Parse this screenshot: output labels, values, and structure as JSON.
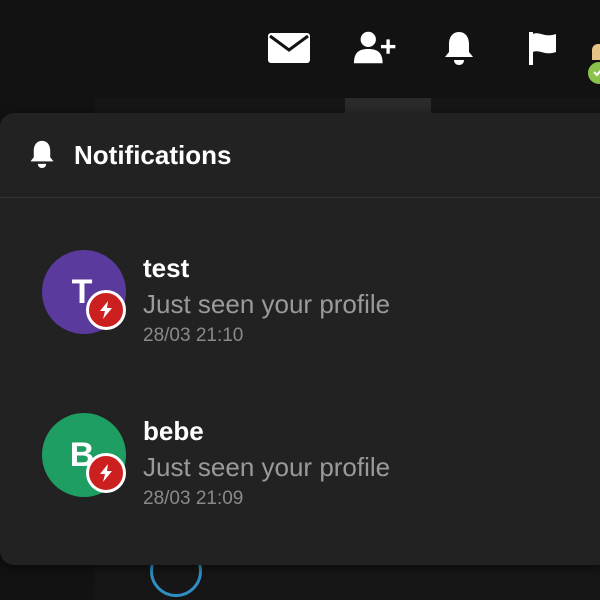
{
  "topbar": {
    "icons": [
      "mail-icon",
      "add-user-icon",
      "bell-icon",
      "flag-icon",
      "user-status-icon"
    ]
  },
  "panel": {
    "title": "Notifications",
    "header_icon": "bell-icon"
  },
  "notifications": [
    {
      "name": "test",
      "initial": "T",
      "avatar_color": "#5b3a9e",
      "message": "Just seen your profile",
      "time": "28/03 21:10",
      "badge_icon": "flash-icon",
      "badge_color": "#cc1f1f"
    },
    {
      "name": "bebe",
      "initial": "B",
      "avatar_color": "#1e9e63",
      "message": "Just seen your profile",
      "time": "28/03 21:09",
      "badge_icon": "flash-icon",
      "badge_color": "#cc1f1f"
    }
  ],
  "colors": {
    "background": "#121212",
    "panel": "#222222",
    "status_online": "#8bc34a"
  }
}
